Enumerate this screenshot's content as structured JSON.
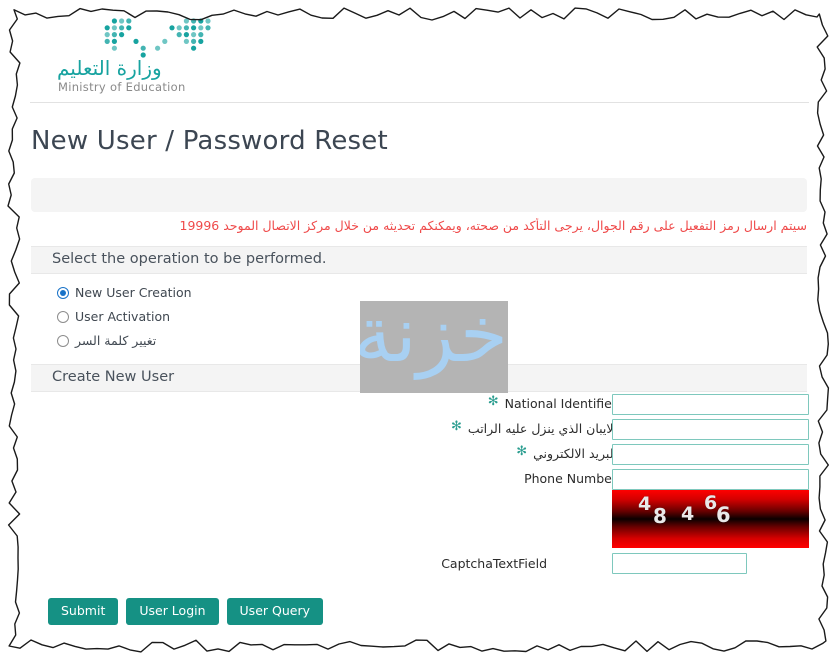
{
  "brand": {
    "arabic_name": "وزارة التعليم",
    "english_name": "Ministry of Education",
    "logo_color": "#17a3a0"
  },
  "page": {
    "title": "New User / Password Reset"
  },
  "alert": {
    "text": "سيتم ارسال رمز التفعيل على رقم الجوال، يرجى التأكد من صحته، ويمكنكم تحديثه من خلال مركز الاتصال الموحد 19996",
    "color": "#ef4a4a"
  },
  "operation_section": {
    "header": "Select the operation to be performed.",
    "options": [
      {
        "label": "New User Creation",
        "selected": true,
        "rtl": false
      },
      {
        "label": "User Activation",
        "selected": false,
        "rtl": false
      },
      {
        "label": "تغيير كلمة السر",
        "selected": false,
        "rtl": true
      }
    ]
  },
  "watermark": {
    "text": "خزنة",
    "background": "#b4b4b4",
    "text_color": "#a8d0f2"
  },
  "form_section": {
    "header": "Create New User",
    "required_marker": "✻",
    "required_color": "#2a9d8f",
    "fields": [
      {
        "label": "National Identifier",
        "value": "",
        "placeholder": "",
        "required": true,
        "rtl": false
      },
      {
        "label": "الايبان الذي ينزل عليه الراتب",
        "value": "",
        "placeholder": "",
        "required": true,
        "rtl": true
      },
      {
        "label": "البريد الالكتروني",
        "value": "",
        "placeholder": "",
        "required": true,
        "rtl": true
      },
      {
        "label": "Phone Number",
        "value": "",
        "placeholder": "",
        "required": false,
        "rtl": false
      }
    ],
    "captcha": {
      "digits": [
        "4",
        "8",
        "4",
        "6",
        "6"
      ],
      "value_text": "48466",
      "field_label": "CaptchaTextField",
      "field_value": "",
      "field_placeholder": ""
    }
  },
  "buttons": [
    {
      "label": "Submit"
    },
    {
      "label": "User Login"
    },
    {
      "label": "User Query"
    }
  ],
  "theme": {
    "teal": "#159184",
    "input_border": "#7ec8bd",
    "radio_selected": "#1a73c8",
    "panel_gray": "#f4f4f4"
  }
}
